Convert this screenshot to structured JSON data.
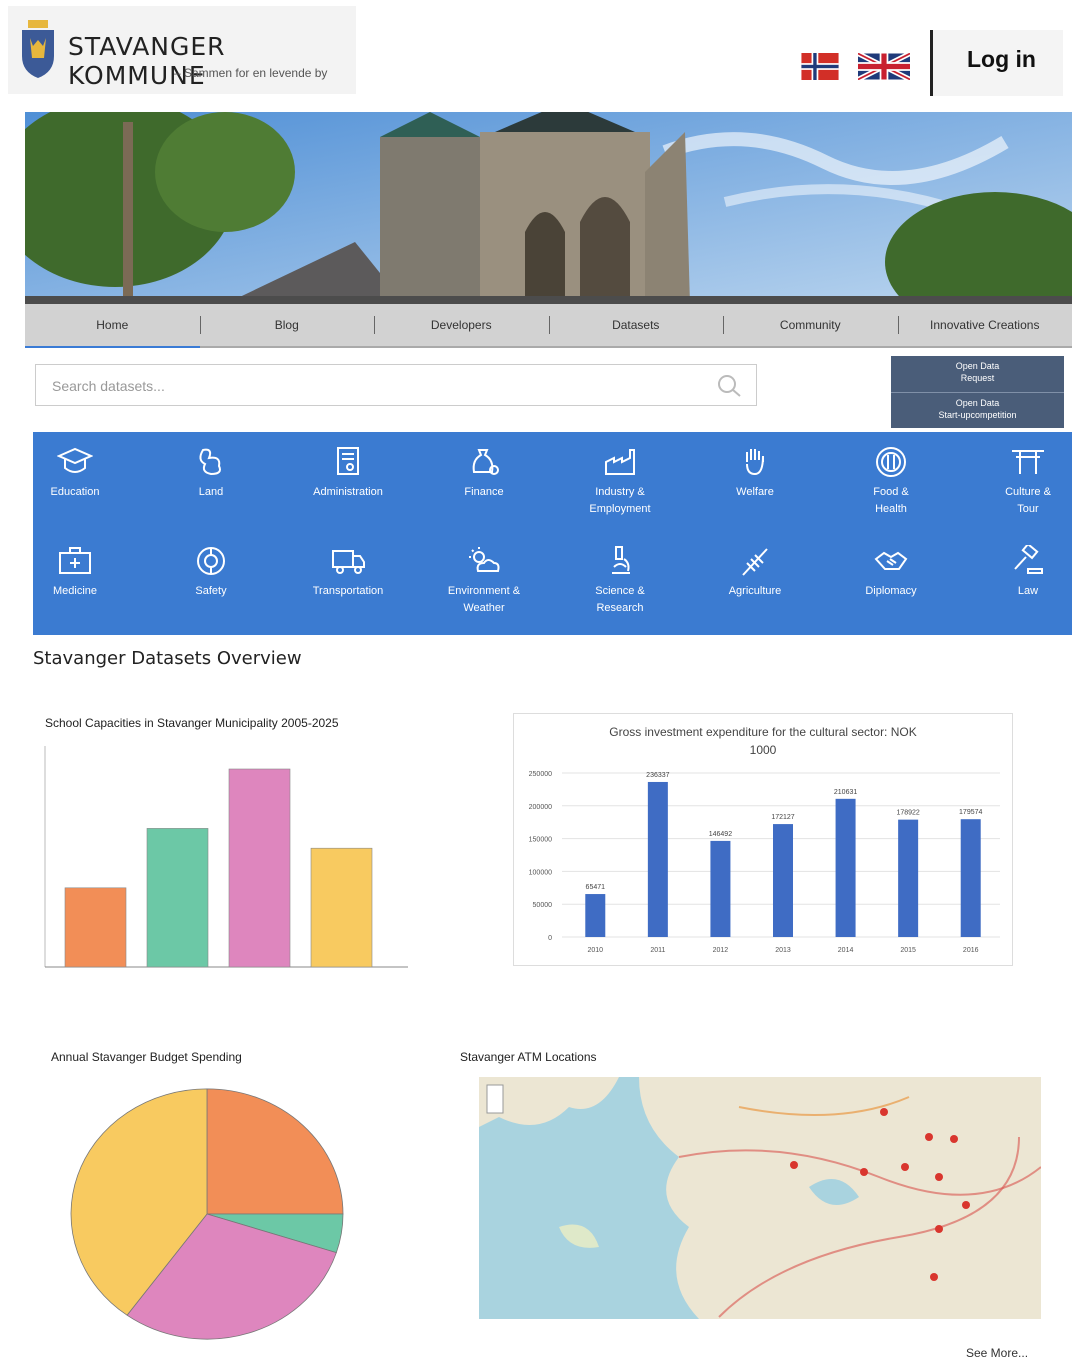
{
  "header": {
    "brand_name": "STAVANGER KOMMUNE",
    "brand_tagline": "– Sammen for en levende by",
    "login_label": "Log in",
    "language_options": [
      "Norwegian",
      "English"
    ]
  },
  "nav": {
    "items": [
      "Home",
      "Blog",
      "Developers",
      "Datasets",
      "Community",
      "Innovative Creations"
    ],
    "active": "Home"
  },
  "search": {
    "placeholder": "Search datasets..."
  },
  "open_data": {
    "request_line1": "Open Data",
    "request_line2": "Request",
    "competition_line1": "Open Data",
    "competition_line2": "Start-upcompetition"
  },
  "categories": {
    "row1": [
      {
        "line1": "Education",
        "line2": "",
        "icon": "graduation-cap-icon"
      },
      {
        "line1": "Land",
        "line2": "",
        "icon": "land-icon"
      },
      {
        "line1": "Administration",
        "line2": "",
        "icon": "certificate-icon"
      },
      {
        "line1": "Finance",
        "line2": "",
        "icon": "money-bag-icon"
      },
      {
        "line1": "Industry &",
        "line2": "Employment",
        "icon": "factory-icon"
      },
      {
        "line1": "Welfare",
        "line2": "",
        "icon": "hand-icon"
      },
      {
        "line1": "Food &",
        "line2": "Health",
        "icon": "plate-cutlery-icon"
      },
      {
        "line1": "Culture &",
        "line2": "Tour",
        "icon": "torii-gate-icon"
      }
    ],
    "row2": [
      {
        "line1": "Medicine",
        "line2": "",
        "icon": "medical-kit-icon"
      },
      {
        "line1": "Safety",
        "line2": "",
        "icon": "lifebuoy-icon"
      },
      {
        "line1": "Transportation",
        "line2": "",
        "icon": "truck-icon"
      },
      {
        "line1": "Environment &",
        "line2": "Weather",
        "icon": "sun-cloud-icon"
      },
      {
        "line1": "Science &",
        "line2": "Research",
        "icon": "microscope-icon"
      },
      {
        "line1": "Agriculture",
        "line2": "",
        "icon": "wheat-icon"
      },
      {
        "line1": "Diplomacy",
        "line2": "",
        "icon": "handshake-icon"
      },
      {
        "line1": "Law",
        "line2": "",
        "icon": "gavel-icon"
      }
    ]
  },
  "overview": {
    "title": "Stavanger Datasets Overview",
    "see_more": "See More..."
  },
  "colors": {
    "orange": "#f28e57",
    "teal": "#6cc8a6",
    "pink": "#de86be",
    "yellow": "#f8ca60",
    "blue_bar": "#3f6cc4",
    "category_bg": "#3b7bd1"
  },
  "chart_data": [
    {
      "type": "bar",
      "title": "School Capacities in Stavanger Municipality 2005-2025",
      "categories": [
        "",
        "",
        "",
        ""
      ],
      "values": [
        40,
        70,
        100,
        60
      ],
      "colors": [
        "#f28e57",
        "#6cc8a6",
        "#de86be",
        "#f8ca60"
      ],
      "ylim": [
        0,
        100
      ],
      "grid": false
    },
    {
      "type": "bar",
      "title": "Gross investment expenditure for the cultural sector: NOK 1000",
      "categories": [
        "2010",
        "2011",
        "2012",
        "2013",
        "2014",
        "2015",
        "2016"
      ],
      "values": [
        65471,
        236337,
        146492,
        172127,
        210631,
        178922,
        179574
      ],
      "ylim": [
        0,
        250000
      ],
      "yticks": [
        "0",
        "50000",
        "100000",
        "150000",
        "200000",
        "250000"
      ],
      "grid": true
    },
    {
      "type": "pie",
      "title": "Annual Stavanger Budget Spending",
      "values": [
        25,
        5,
        30,
        40
      ],
      "colors": [
        "#f28e57",
        "#6cc8a6",
        "#de86be",
        "#f8ca60"
      ]
    }
  ],
  "map": {
    "title": "Stavanger ATM Locations"
  }
}
